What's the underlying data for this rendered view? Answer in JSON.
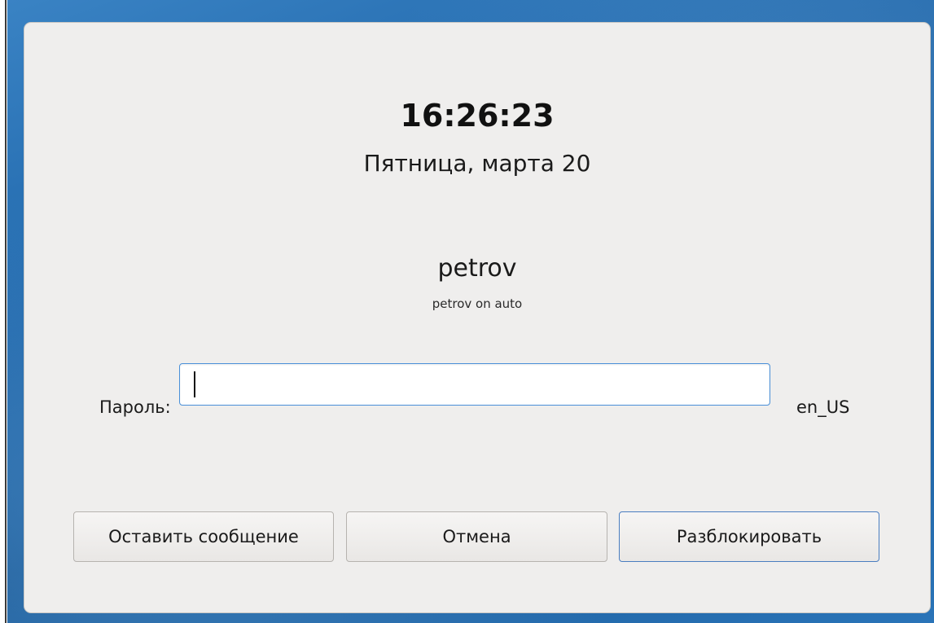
{
  "clock": {
    "time": "16:26:23",
    "date": "Пятница, марта 20"
  },
  "user": {
    "name": "petrov",
    "host": "petrov on auto"
  },
  "password": {
    "label": "Пароль:",
    "value": "",
    "locale": "en_US"
  },
  "buttons": {
    "leave_message": "Оставить сообщение",
    "cancel": "Отмена",
    "unlock": "Разблокировать"
  },
  "colors": {
    "dialog_bg": "#efeeed",
    "desktop_bg": "#1f66aa",
    "focus_border": "#4a90d9"
  }
}
